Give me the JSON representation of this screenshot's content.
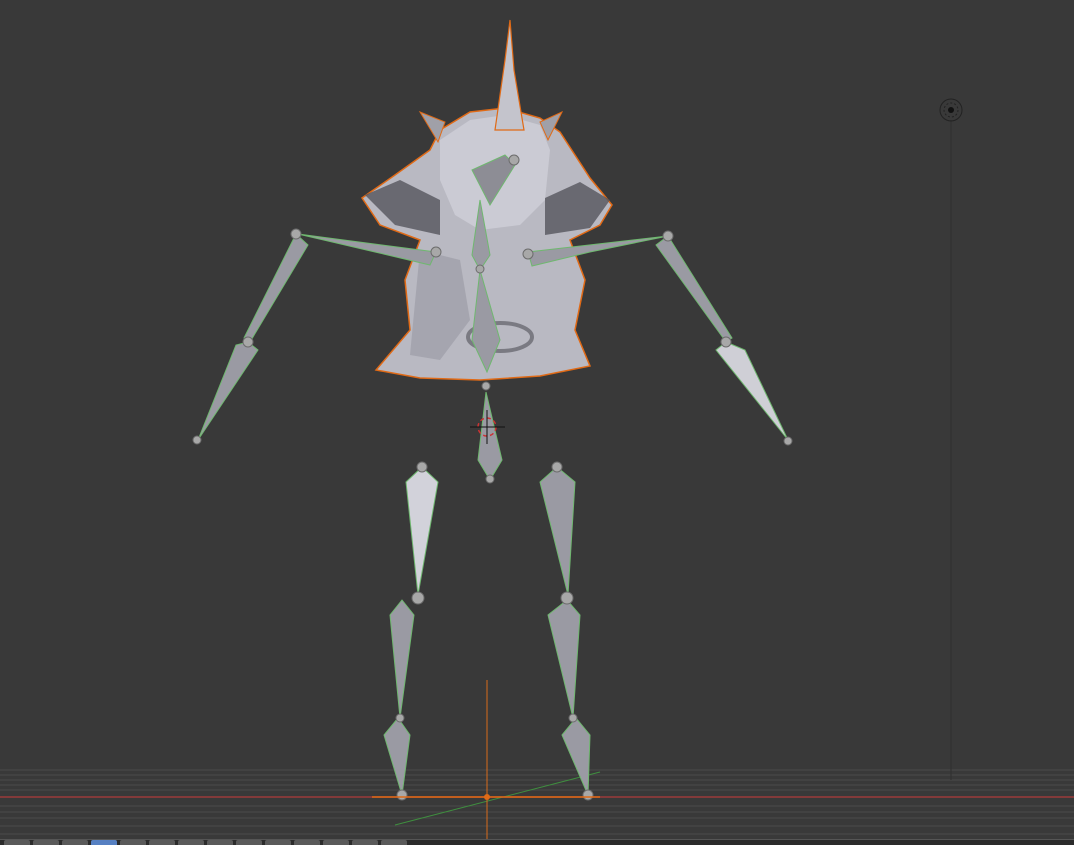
{
  "viewport": {
    "background": "#393939",
    "grid_color": "#4a4a4a",
    "x_axis_color": "#9c3b3b",
    "y_axis_color": "#3f8f3f",
    "z_axis_color": "#d86a1c",
    "mesh_color": "#b9b9c2",
    "mesh_outline": "#e06a16",
    "bone_fill": "#9a9aa3",
    "bone_outline": "#6fb86f",
    "bone_joint": "#a8a8a8",
    "selected_outline": "#e8821e"
  },
  "icons": {
    "camera": "camera-icon",
    "cursor": "3d-cursor-icon",
    "origin": "origin-icon"
  },
  "toolbar": {
    "button_count": 14,
    "active_index": 3
  }
}
